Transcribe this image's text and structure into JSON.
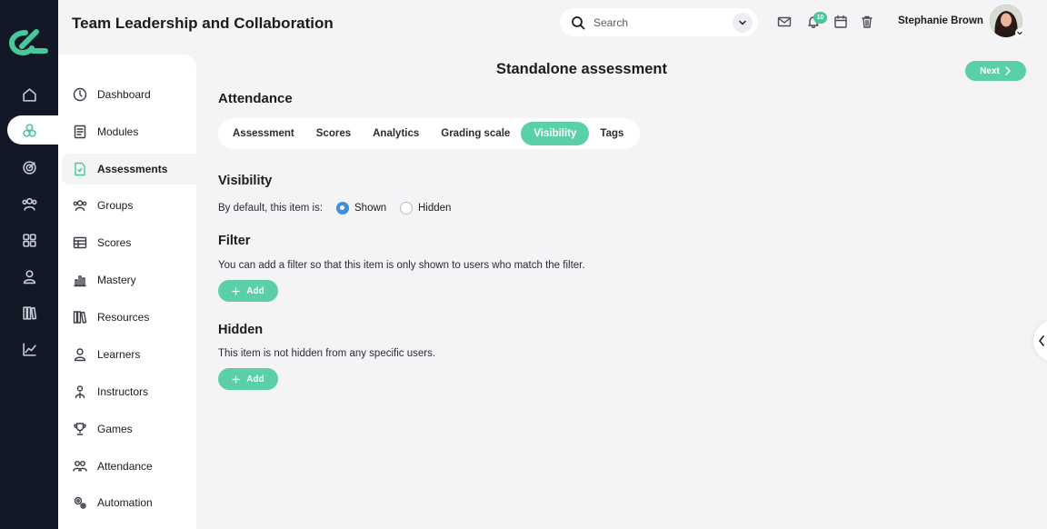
{
  "header": {
    "title": "Team Leadership and Collaboration",
    "search_placeholder": "Search",
    "notification_count": "10",
    "user_name": "Stephanie Brown"
  },
  "rail": {
    "icons": [
      "home-icon",
      "modules-icon",
      "target-icon",
      "groups-icon",
      "grid-icon",
      "user-icon",
      "library-icon",
      "chart-icon"
    ],
    "active_index": 1
  },
  "sidebar": {
    "items": [
      {
        "label": "Dashboard",
        "icon": "dashboard-icon"
      },
      {
        "label": "Modules",
        "icon": "modules-icon"
      },
      {
        "label": "Assessments",
        "icon": "assessments-icon",
        "active": true
      },
      {
        "label": "Groups",
        "icon": "groups-icon"
      },
      {
        "label": "Scores",
        "icon": "scores-icon"
      },
      {
        "label": "Mastery",
        "icon": "mastery-icon"
      },
      {
        "label": "Resources",
        "icon": "resources-icon"
      },
      {
        "label": "Learners",
        "icon": "learners-icon"
      },
      {
        "label": "Instructors",
        "icon": "instructors-icon"
      },
      {
        "label": "Games",
        "icon": "trophy-icon"
      },
      {
        "label": "Attendance",
        "icon": "attendance-icon"
      },
      {
        "label": "Automation",
        "icon": "automation-icon"
      }
    ]
  },
  "main": {
    "page_title": "Standalone assessment",
    "next_label": "Next",
    "section_title": "Attendance",
    "tabs": [
      {
        "label": "Assessment"
      },
      {
        "label": "Scores"
      },
      {
        "label": "Analytics"
      },
      {
        "label": "Grading scale"
      },
      {
        "label": "Visibility",
        "active": true
      },
      {
        "label": "Tags"
      }
    ],
    "visibility": {
      "heading": "Visibility",
      "prompt": "By default, this item is:",
      "options": [
        "Shown",
        "Hidden"
      ],
      "selected": "Shown"
    },
    "filter": {
      "heading": "Filter",
      "description": "You can add a filter so that this item is only shown to users who match the filter.",
      "add_label": "Add"
    },
    "hidden": {
      "heading": "Hidden",
      "description": "This item is not hidden from any specific users.",
      "add_label": "Add"
    }
  },
  "colors": {
    "accent": "#5bd0a6",
    "rail_bg": "#121826",
    "radio_selected": "#3d8fe0"
  }
}
